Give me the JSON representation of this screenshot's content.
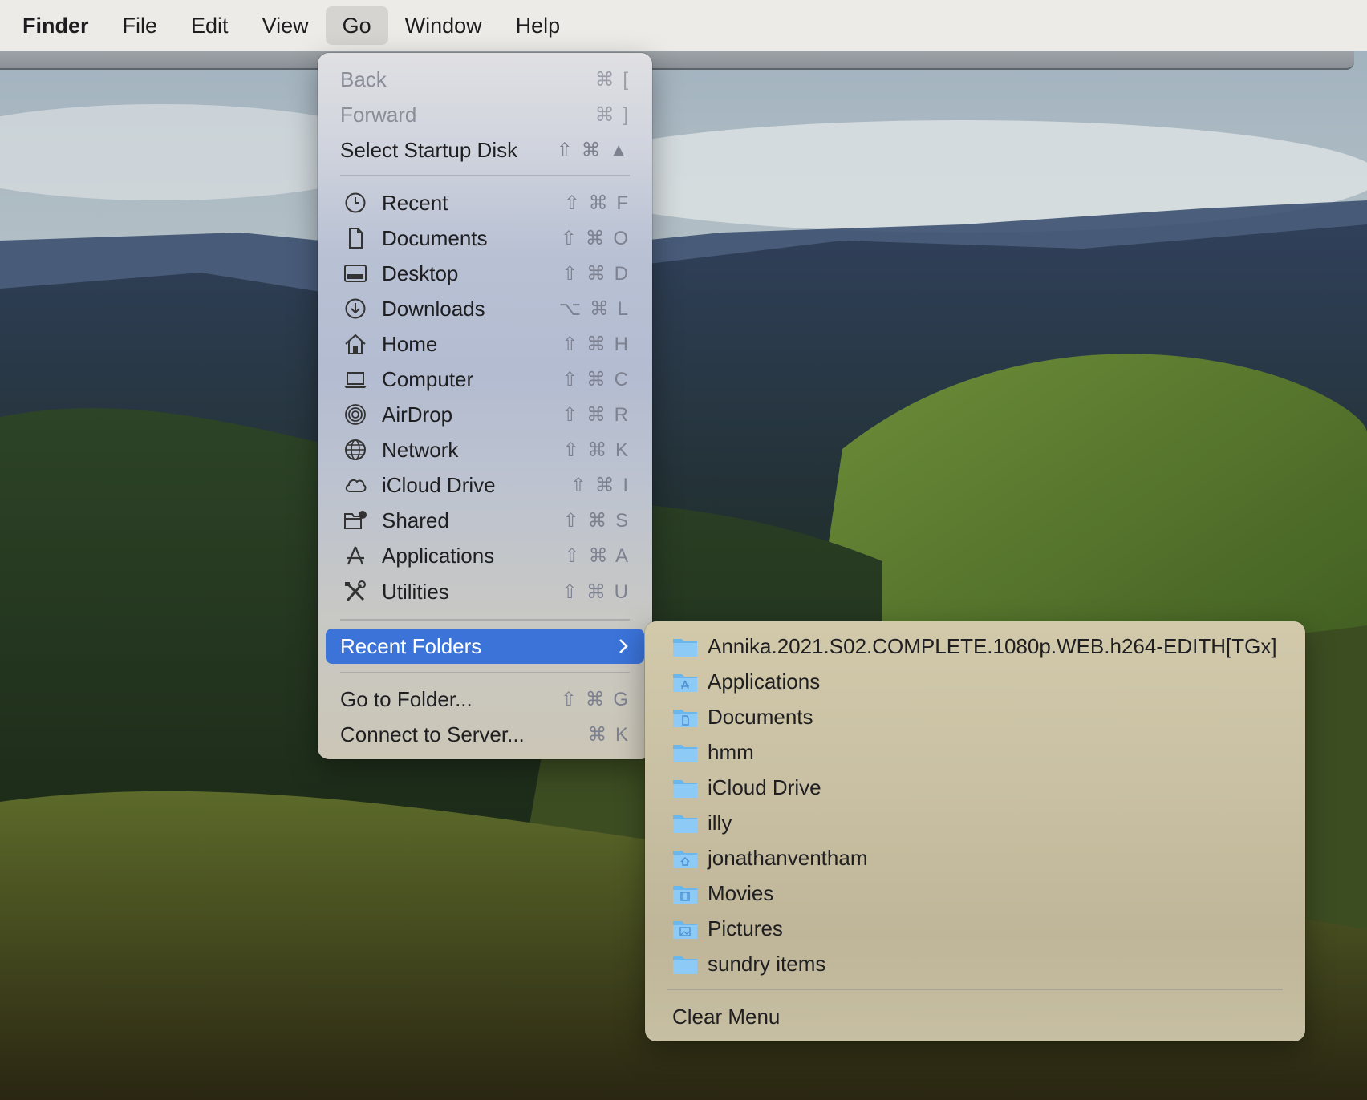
{
  "menubar": {
    "app": "Finder",
    "items": [
      "File",
      "Edit",
      "View",
      "Go",
      "Window",
      "Help"
    ],
    "active": "Go"
  },
  "go_menu": {
    "nav": [
      {
        "label": "Back",
        "shortcut": "⌘ [",
        "enabled": false
      },
      {
        "label": "Forward",
        "shortcut": "⌘ ]",
        "enabled": false
      },
      {
        "label": "Select Startup Disk",
        "shortcut": "⇧ ⌘ ▲",
        "enabled": true
      }
    ],
    "places": [
      {
        "label": "Recent",
        "shortcut": "⇧ ⌘ F",
        "icon": "clock-icon"
      },
      {
        "label": "Documents",
        "shortcut": "⇧ ⌘ O",
        "icon": "document-icon"
      },
      {
        "label": "Desktop",
        "shortcut": "⇧ ⌘ D",
        "icon": "desktop-icon"
      },
      {
        "label": "Downloads",
        "shortcut": "⌥ ⌘ L",
        "icon": "download-icon"
      },
      {
        "label": "Home",
        "shortcut": "⇧ ⌘ H",
        "icon": "home-icon"
      },
      {
        "label": "Computer",
        "shortcut": "⇧ ⌘ C",
        "icon": "laptop-icon"
      },
      {
        "label": "AirDrop",
        "shortcut": "⇧ ⌘ R",
        "icon": "airdrop-icon"
      },
      {
        "label": "Network",
        "shortcut": "⇧ ⌘ K",
        "icon": "globe-icon"
      },
      {
        "label": "iCloud Drive",
        "shortcut": "⇧ ⌘ I",
        "icon": "cloud-icon"
      },
      {
        "label": "Shared",
        "shortcut": "⇧ ⌘ S",
        "icon": "shared-folder-icon"
      },
      {
        "label": "Applications",
        "shortcut": "⇧ ⌘ A",
        "icon": "applications-icon"
      },
      {
        "label": "Utilities",
        "shortcut": "⇧ ⌘ U",
        "icon": "tools-icon"
      }
    ],
    "recent_folders": {
      "label": "Recent Folders"
    },
    "actions": [
      {
        "label": "Go to Folder...",
        "shortcut": "⇧ ⌘ G"
      },
      {
        "label": "Connect to Server...",
        "shortcut": "⌘ K"
      }
    ]
  },
  "recent_folders_menu": {
    "folders": [
      {
        "label": "Annika.2021.S02.COMPLETE.1080p.WEB.h264-EDITH[TGx]",
        "icon": "folder-icon"
      },
      {
        "label": "Applications",
        "icon": "applications-folder-icon"
      },
      {
        "label": "Documents",
        "icon": "documents-folder-icon"
      },
      {
        "label": "hmm",
        "icon": "folder-icon"
      },
      {
        "label": "iCloud Drive",
        "icon": "folder-icon"
      },
      {
        "label": "illy",
        "icon": "folder-icon"
      },
      {
        "label": "jonathanventham",
        "icon": "home-folder-icon"
      },
      {
        "label": "Movies",
        "icon": "movies-folder-icon"
      },
      {
        "label": "Pictures",
        "icon": "pictures-folder-icon"
      },
      {
        "label": "sundry items",
        "icon": "folder-icon"
      }
    ],
    "clear_label": "Clear Menu"
  },
  "colors": {
    "highlight": "#3b73d9",
    "folder": "#6cb6ee",
    "menubar": "#ecebe7"
  }
}
